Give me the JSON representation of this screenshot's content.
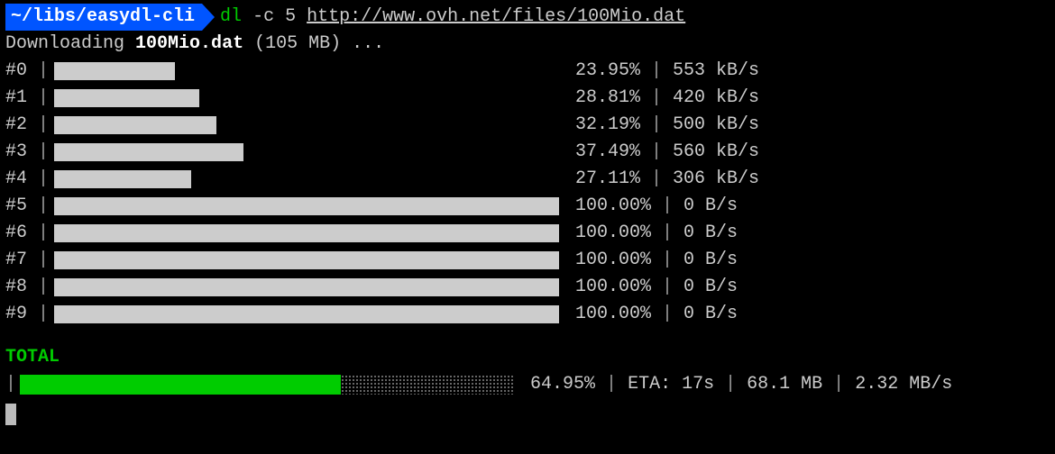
{
  "prompt": {
    "path": "~/libs/easydl-cli",
    "arrow_char": "❯",
    "command_name": "dl",
    "command_flags": "-c 5",
    "command_url": "http://www.ovh.net/files/100Mio.dat"
  },
  "status": {
    "prefix": "Downloading",
    "filename": "100Mio.dat",
    "size": "(105 MB)",
    "suffix": "..."
  },
  "chunks": [
    {
      "id": "#0",
      "percent": 23.95,
      "percent_text": "23.95%",
      "speed": "553 kB/s"
    },
    {
      "id": "#1",
      "percent": 28.81,
      "percent_text": "28.81%",
      "speed": "420 kB/s"
    },
    {
      "id": "#2",
      "percent": 32.19,
      "percent_text": "32.19%",
      "speed": "500 kB/s"
    },
    {
      "id": "#3",
      "percent": 37.49,
      "percent_text": "37.49%",
      "speed": "560 kB/s"
    },
    {
      "id": "#4",
      "percent": 27.11,
      "percent_text": "27.11%",
      "speed": "306 kB/s"
    },
    {
      "id": "#5",
      "percent": 100.0,
      "percent_text": "100.00%",
      "speed": "0 B/s"
    },
    {
      "id": "#6",
      "percent": 100.0,
      "percent_text": "100.00%",
      "speed": "0 B/s"
    },
    {
      "id": "#7",
      "percent": 100.0,
      "percent_text": "100.00%",
      "speed": "0 B/s"
    },
    {
      "id": "#8",
      "percent": 100.0,
      "percent_text": "100.00%",
      "speed": "0 B/s"
    },
    {
      "id": "#9",
      "percent": 100.0,
      "percent_text": "100.00%",
      "speed": "0 B/s"
    }
  ],
  "total": {
    "label": "TOTAL",
    "percent": 64.95,
    "percent_text": "64.95%",
    "eta_label": "ETA:",
    "eta": "17s",
    "downloaded": "68.1 MB",
    "speed": "2.32 MB/s"
  },
  "colors": {
    "prompt_bg": "#0055ff",
    "green": "#00cc00",
    "bar": "#ccc",
    "total_bar": "#00cc00"
  }
}
